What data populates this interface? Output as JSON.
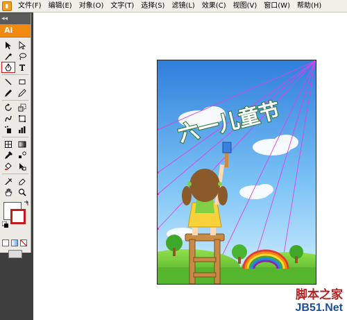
{
  "app": {
    "logo_label": "Ai",
    "panel_collapse": "◂◂"
  },
  "menubar": {
    "items": [
      "文件(F)",
      "编辑(E)",
      "对象(O)",
      "文字(T)",
      "选择(S)",
      "滤镜(L)",
      "效果(C)",
      "视图(V)",
      "窗口(W)",
      "帮助(H)"
    ]
  },
  "toolbox": {
    "active_tool": "pen-tool",
    "tools": [
      [
        "selection-tool",
        "direct-selection-tool"
      ],
      [
        "magic-wand-tool",
        "lasso-tool"
      ],
      [
        "pen-tool",
        "type-tool"
      ],
      [
        "line-segment-tool",
        "rectangle-tool"
      ],
      [
        "paintbrush-tool",
        "pencil-tool"
      ],
      [
        "rotate-tool",
        "scale-tool"
      ],
      [
        "warp-tool",
        "free-transform-tool"
      ],
      [
        "symbol-sprayer-tool",
        "column-graph-tool"
      ],
      [
        "mesh-tool",
        "gradient-tool"
      ],
      [
        "eyedropper-tool",
        "blend-tool"
      ],
      [
        "live-paint-bucket-tool",
        "live-paint-selection-tool"
      ],
      [
        "slice-tool",
        "eraser-tool"
      ],
      [
        "hand-tool",
        "zoom-tool"
      ]
    ],
    "colors": {
      "fill": "#ffffff",
      "stroke": "#c11b1b"
    }
  },
  "artwork": {
    "title_text": "六一儿童节",
    "colors": {
      "sky_top": "#3a86e0",
      "sky_bottom": "#bfe6ff",
      "grass": "#6fcf3a",
      "guide": "#e040e8"
    }
  },
  "watermark": {
    "line1": "脚本之家",
    "line2": "JB51.Net"
  }
}
